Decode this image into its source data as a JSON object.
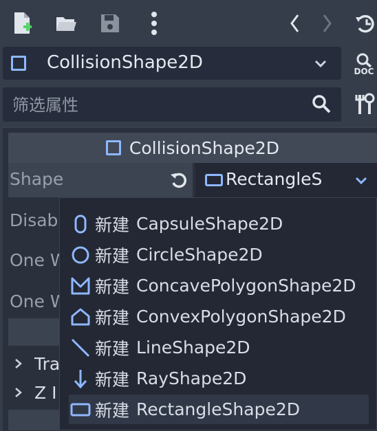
{
  "toolbar": {
    "doc_label": "DOC"
  },
  "object": {
    "name": "CollisionShape2D"
  },
  "filter": {
    "placeholder": "筛选属性"
  },
  "inspector": {
    "header": "CollisionShape2D",
    "shape_label": "Shape",
    "shape_value": "RectangleS",
    "rows": [
      "Disab",
      "One W",
      "One W"
    ],
    "sections": [
      "Tra",
      "Z I"
    ]
  },
  "popup": {
    "items": [
      {
        "prefix": "新建",
        "name": "CapsuleShape2D",
        "icon": "capsule-icon"
      },
      {
        "prefix": "新建",
        "name": "CircleShape2D",
        "icon": "circle-icon"
      },
      {
        "prefix": "新建",
        "name": "ConcavePolygonShape2D",
        "icon": "concave-polygon-icon"
      },
      {
        "prefix": "新建",
        "name": "ConvexPolygonShape2D",
        "icon": "convex-polygon-icon"
      },
      {
        "prefix": "新建",
        "name": "LineShape2D",
        "icon": "line-icon"
      },
      {
        "prefix": "新建",
        "name": "RayShape2D",
        "icon": "ray-arrow-icon"
      },
      {
        "prefix": "新建",
        "name": "RectangleShape2D",
        "icon": "rectangle-icon"
      }
    ]
  },
  "colors": {
    "accent": "#8eb8ff",
    "icon": "#dfe4ec",
    "panel": "#2a303c"
  }
}
